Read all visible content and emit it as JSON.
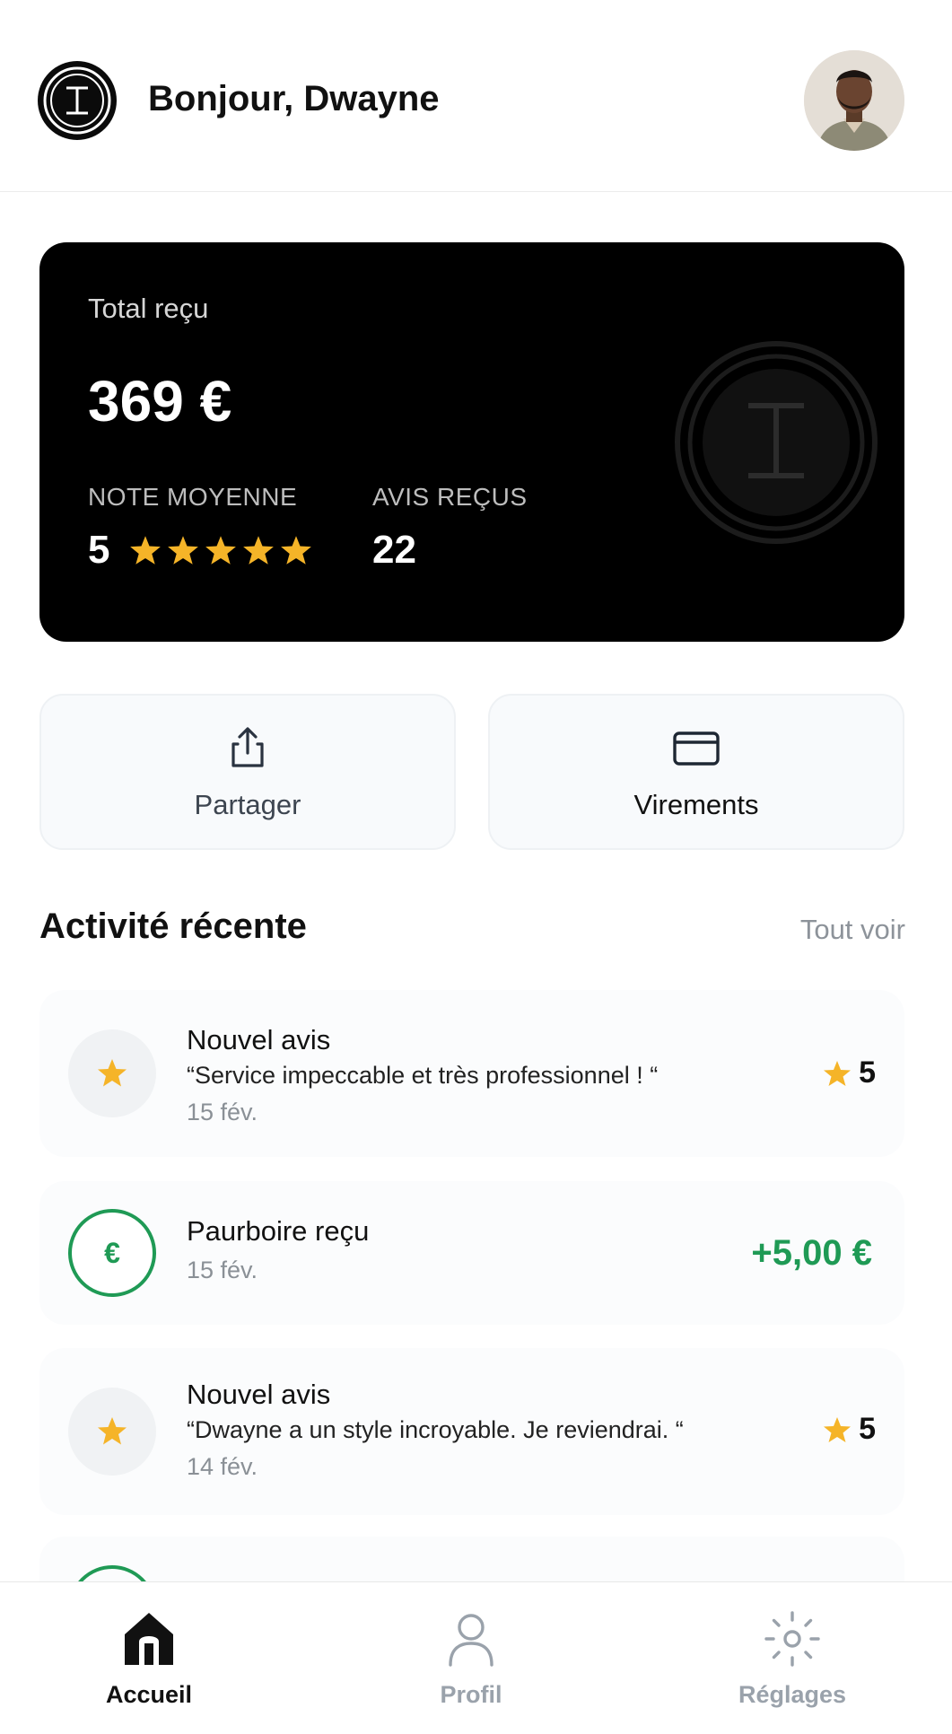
{
  "header": {
    "greeting": "Bonjour, Dwayne",
    "logo_icon": "brand-logo-icon",
    "avatar_icon": "user-avatar-photo"
  },
  "balance_card": {
    "total_label": "Total reçu",
    "total_amount": "369 €",
    "average_rating_label": "NOTE MOYENNE",
    "average_rating_value": "5",
    "average_rating_stars": 5,
    "reviews_label": "AVIS REÇUS",
    "reviews_count": "22"
  },
  "actions": {
    "share_label": "Partager",
    "share_icon": "share-icon",
    "transfers_label": "Virements",
    "transfers_icon": "credit-card-icon"
  },
  "activity": {
    "title": "Activité récente",
    "see_all": "Tout voir",
    "items": [
      {
        "type": "review",
        "title": "Nouvel avis",
        "quote": "“Service impeccable et très professionnel ! “",
        "date": "15 fév.",
        "rating": "5"
      },
      {
        "type": "tip",
        "title": "Paurboire reçu",
        "date": "15 fév.",
        "amount": "+5,00 €"
      },
      {
        "type": "review",
        "title": "Nouvel avis",
        "quote": "“Dwayne a un style incroyable. Je reviendrai. “",
        "date": "14 fév.",
        "rating": "5"
      }
    ]
  },
  "bottom_nav": {
    "home_label": "Accueil",
    "profile_label": "Profil",
    "settings_label": "Réglages",
    "active": "Accueil"
  },
  "colors": {
    "accent_green": "#1f9a55",
    "star_yellow": "#f5b428",
    "card_background": "#000000",
    "muted_text": "#8d939a"
  }
}
